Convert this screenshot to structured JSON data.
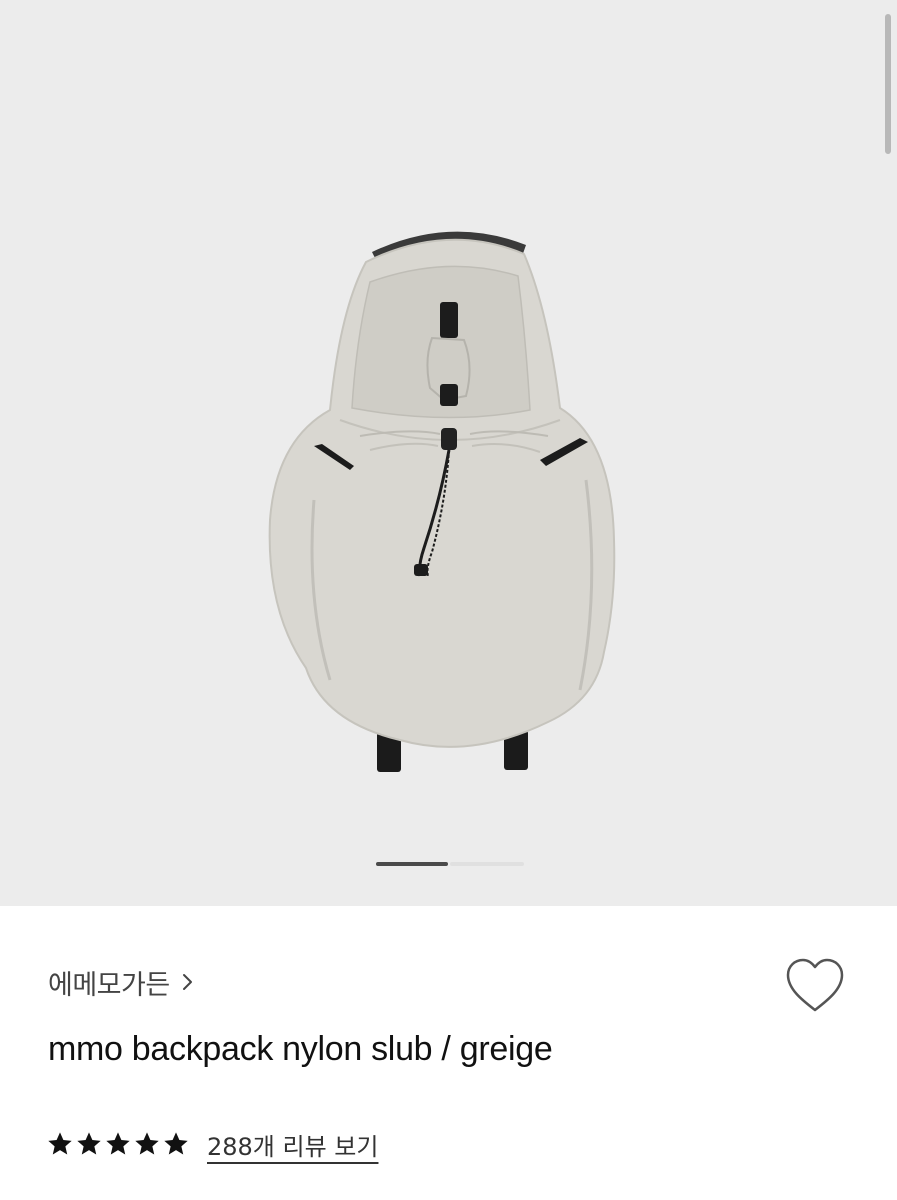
{
  "gallery": {
    "background_color": "#ececec",
    "current_slide_index": 0,
    "image_subject": "backpack",
    "product_color": "#d9d7d1"
  },
  "product": {
    "brand_name": "에메모가든",
    "brand_link_icon": "chevron-right-icon",
    "name": "mmo backpack nylon slub / greige",
    "wishlist_icon": "heart-outline-icon",
    "rating": {
      "stars": 5,
      "max_stars": 5,
      "star_icon": "star-filled-icon",
      "review_link_text": "288개 리뷰 보기"
    }
  }
}
